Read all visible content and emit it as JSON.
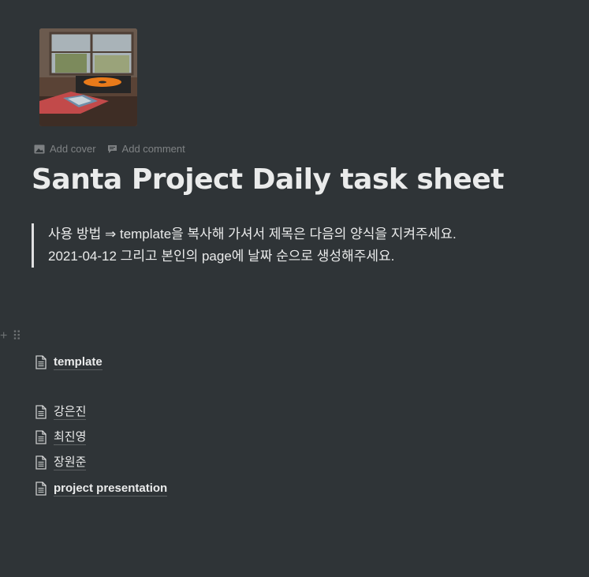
{
  "page": {
    "icon": "record-player-photo",
    "controls": {
      "add_cover": "Add cover",
      "add_comment": "Add comment"
    },
    "title": "Santa Project Daily task sheet",
    "quote": {
      "line1": "사용 방법 ⇒ template을 복사해 가셔서 제목은 다음의 양식을 지켜주세요.",
      "line2": "2021-04-12 그리고 본인의 page에 날짜 순으로 생성해주세요."
    },
    "block_handle": {
      "plus": "+",
      "drag": "⠿"
    },
    "links": [
      {
        "label": "template",
        "bold": true
      },
      {
        "label": "강은진",
        "bold": false
      },
      {
        "label": "최진영",
        "bold": false
      },
      {
        "label": "장원준",
        "bold": false
      },
      {
        "label": "project presentation",
        "bold": true
      }
    ]
  },
  "colors": {
    "background": "#2f3437",
    "text": "#e6e6e6",
    "muted": "#6b6f72"
  }
}
